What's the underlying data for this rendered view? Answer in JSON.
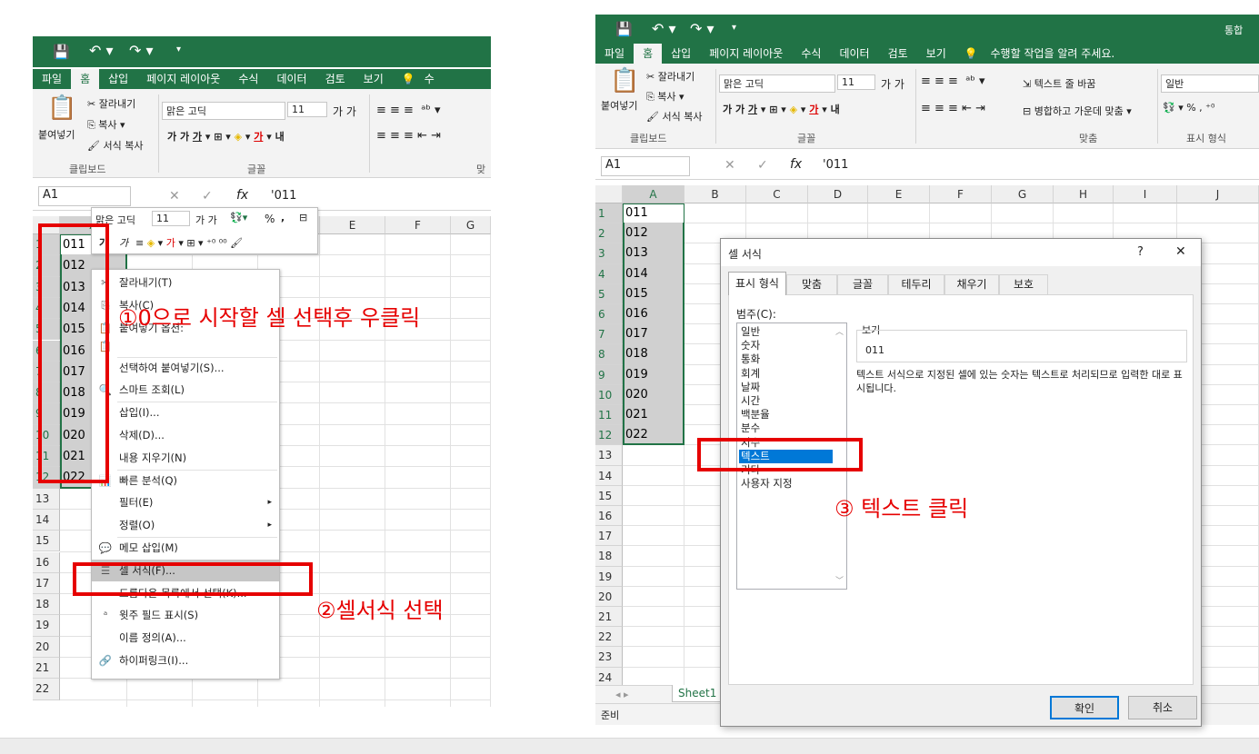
{
  "left": {
    "tabs": [
      "파일",
      "홈",
      "삽입",
      "페이지 레이아웃",
      "수식",
      "데이터",
      "검토",
      "보기",
      "수"
    ],
    "ribbon": {
      "paste": "붙여넣기",
      "cut": "잘라내기",
      "copy": "복사",
      "format_painter": "서식 복사",
      "clipboard": "클립보드",
      "font_name": "맑은 고딕",
      "font_size": "11",
      "font_group": "글꼴",
      "align_group": "맞"
    },
    "name_box": "A1",
    "formula": "'011",
    "fx": "fx",
    "columns": [
      "A",
      "B",
      "C",
      "D",
      "E",
      "F",
      "G"
    ],
    "rows": [
      "1",
      "2",
      "3",
      "4",
      "5",
      "6",
      "7",
      "8",
      "9",
      "10",
      "11",
      "12",
      "13",
      "14",
      "15",
      "16",
      "17",
      "18",
      "19",
      "20",
      "21",
      "22"
    ],
    "values": [
      "011",
      "012",
      "013",
      "014",
      "015",
      "016",
      "017",
      "018",
      "019",
      "020",
      "021",
      "022"
    ],
    "mini_toolbar": {
      "font": "맑은 고딕",
      "size": "11",
      "bold": "가",
      "italic": "가",
      "percent": "%",
      "comma": ","
    },
    "menu": [
      "잘라내기(T)",
      "복사(C)",
      "붙여넣기 옵션:",
      "",
      "선택하여 붙여넣기(S)...",
      "스마트 조회(L)",
      "삽입(I)...",
      "삭제(D)...",
      "내용 지우기(N)",
      "빠른 분석(Q)",
      "필터(E)",
      "정렬(O)",
      "메모 삽입(M)",
      "셀 서식(F)...",
      "드롭다운 목록에서 선택(K)...",
      "윗주 필드 표시(S)",
      "이름 정의(A)...",
      "하이퍼링크(I)..."
    ],
    "annotation1": "①0으로 시작할 셀 선택후 우클릭",
    "annotation2": "②셀서식 선택"
  },
  "right": {
    "tabs": [
      "파일",
      "홈",
      "삽입",
      "페이지 레이아웃",
      "수식",
      "데이터",
      "검토",
      "보기",
      "수행할 작업을 알려 주세요."
    ],
    "top_right": "통합",
    "ribbon": {
      "paste": "붙여넣기",
      "cut": "잘라내기",
      "copy": "복사",
      "format_painter": "서식 복사",
      "clipboard": "클립보드",
      "font_name": "맑은 고딕",
      "font_size": "11",
      "font_group": "글꼴",
      "wrap": "텍스트 줄 바꿈",
      "merge": "병합하고 가운데 맞춤",
      "align_group": "맞춤",
      "number_format": "일반",
      "number_group": "표시 형식"
    },
    "name_box": "A1",
    "formula": "'011",
    "fx": "fx",
    "columns": [
      "A",
      "B",
      "C",
      "D",
      "E",
      "F",
      "G",
      "H",
      "I",
      "J"
    ],
    "rows": [
      "1",
      "2",
      "3",
      "4",
      "5",
      "6",
      "7",
      "8",
      "9",
      "10",
      "11",
      "12",
      "13",
      "14",
      "15",
      "16",
      "17",
      "18",
      "19",
      "20",
      "21",
      "22",
      "23",
      "24"
    ],
    "values": [
      "011",
      "012",
      "013",
      "014",
      "015",
      "016",
      "017",
      "018",
      "019",
      "020",
      "021",
      "022"
    ],
    "sheet_tab": "Sheet1",
    "status": "준비",
    "dialog": {
      "title": "셀 서식",
      "help": "?",
      "close": "✕",
      "tabs": [
        "표시 형식",
        "맞춤",
        "글꼴",
        "테두리",
        "채우기",
        "보호"
      ],
      "category_label": "범주(C):",
      "categories": [
        "일반",
        "숫자",
        "통화",
        "회계",
        "날짜",
        "시간",
        "백분율",
        "분수",
        "지수",
        "텍스트",
        "기타",
        "사용자 지정"
      ],
      "selected": "텍스트",
      "preview_label": "보기",
      "preview_value": "011",
      "description": "텍스트 서식으로 지정된 셀에 있는 숫자는 텍스트로 처리되므로 입력한 대로 표시됩니다.",
      "ok": "확인",
      "cancel": "취소"
    },
    "annotation3": "③ 텍스트 클릭"
  }
}
